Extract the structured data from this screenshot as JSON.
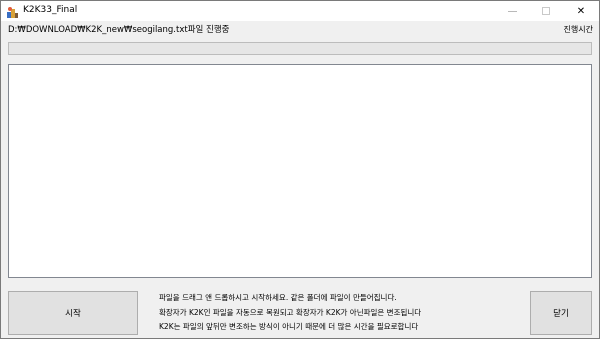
{
  "window": {
    "title": "K2K33_Final"
  },
  "titlebar_buttons": {
    "minimize": "",
    "maximize": "",
    "close": "✕"
  },
  "status": {
    "path_text": "D:₩DOWNLOAD₩K2K_new₩seogilang.txt파일 진행중",
    "elapsed_label": "진행시간"
  },
  "progress": {
    "value": 0
  },
  "log": {
    "content": ""
  },
  "buttons": {
    "start_label": "시작",
    "close_label": "닫기"
  },
  "info_lines": [
    "파일을 드래그 앤 드롭하시고 시작하세요. 같은 폴더에 파일이 만들어집니다.",
    "확장자가 K2K인 파일을 자동으로 복원되고 확장자가 K2K가 아닌파일은 변조됩니다",
    "K2K는 파일의 앞뒤만 변조하는 방식이 아니기 때문에 더 많은 시간을 필요로합니다"
  ],
  "icons": {
    "app": "app-icon",
    "close": "close-icon",
    "minimize": "minimize-icon",
    "maximize": "maximize-icon"
  }
}
